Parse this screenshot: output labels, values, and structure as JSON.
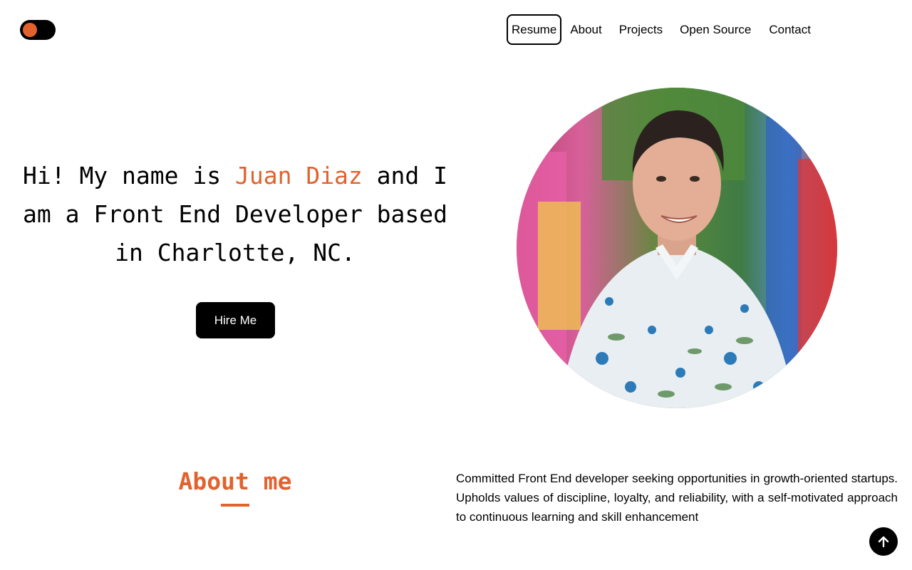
{
  "nav": {
    "resume": "Resume",
    "about": "About",
    "projects": "Projects",
    "open_source": "Open Source",
    "contact": "Contact"
  },
  "hero": {
    "intro": "Hi! My name is ",
    "name": "Juan Diaz",
    "rest": " and I am a Front End Developer based in Charlotte, NC.",
    "hire_label": "Hire Me"
  },
  "about": {
    "title": "About me",
    "text": "Committed Front End developer seeking opportunities in growth-oriented startups. Upholds values of discipline, loyalty, and reliability, with a self-motivated approach to continuous learning and skill enhancement"
  },
  "colors": {
    "accent": "#e2622e",
    "dark": "#000000",
    "background": "#ffffff"
  },
  "icons": {
    "theme_toggle": "theme-toggle",
    "scroll_top": "arrow-up-icon"
  }
}
